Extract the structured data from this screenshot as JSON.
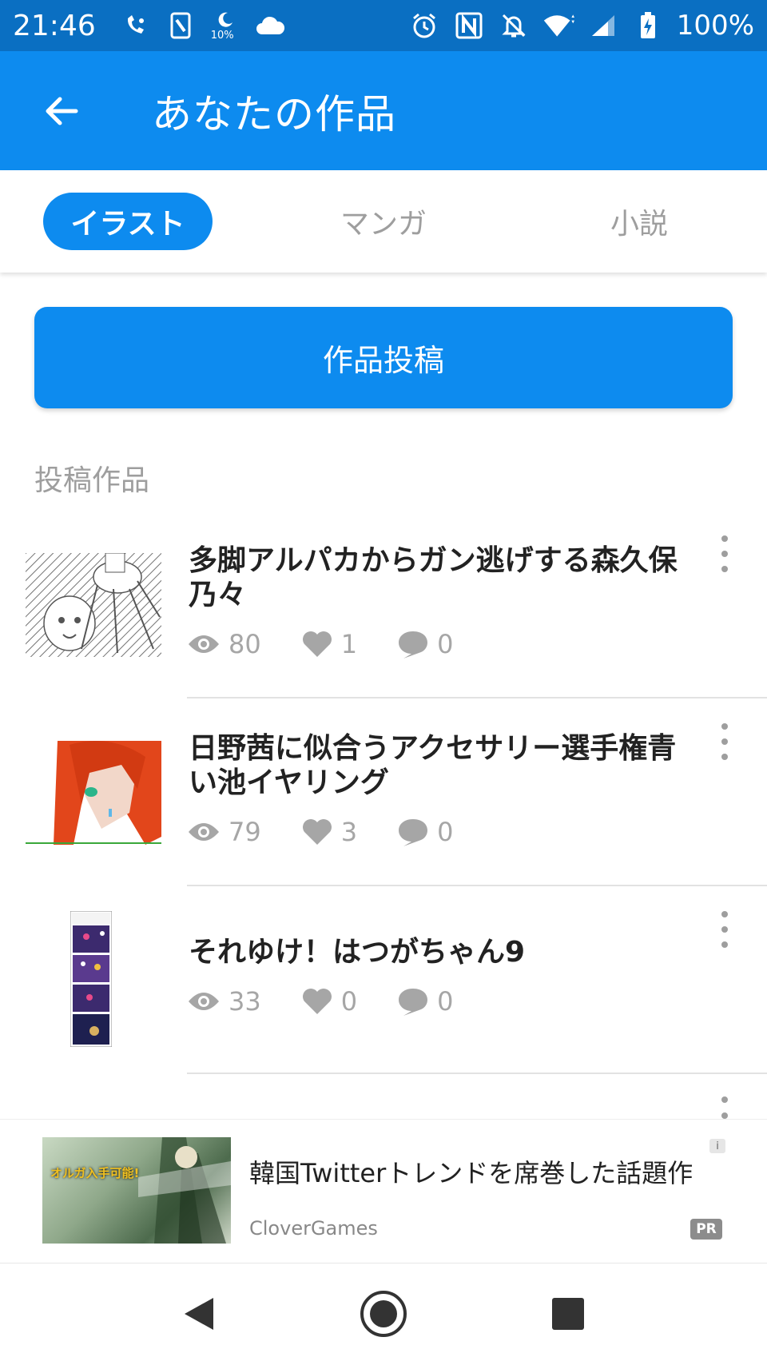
{
  "status_bar": {
    "time": "21:46",
    "moon_percent": "10%",
    "battery": "100%",
    "icons_left": [
      "wifi-calling-icon",
      "nfc-card-icon",
      "moon-icon",
      "cloud-icon"
    ],
    "icons_right": [
      "alarm-icon",
      "nfc-icon",
      "notifications-off-icon",
      "wifi-icon",
      "signal-icon",
      "battery-charging-icon"
    ]
  },
  "header": {
    "title": "あなたの作品"
  },
  "tabs": [
    {
      "label": "イラスト",
      "active": true
    },
    {
      "label": "マンガ",
      "active": false
    },
    {
      "label": "小説",
      "active": false
    }
  ],
  "post_button": {
    "label": "作品投稿"
  },
  "section": {
    "label": "投稿作品"
  },
  "works": [
    {
      "title": "多脚アルパカからガン逃げする森久保乃々",
      "views": "80",
      "likes": "1",
      "comments": "0"
    },
    {
      "title": "日野茜に似合うアクセサリー選手権青い池イヤリング",
      "views": "79",
      "likes": "3",
      "comments": "0"
    },
    {
      "title": "それゆけ！はつがちゃん9",
      "views": "33",
      "likes": "0",
      "comments": "0"
    }
  ],
  "ad": {
    "title": "韓国Twitterトレンドを席巻した話題作",
    "source": "CloverGames",
    "pr_label": "PR",
    "info_label": "i",
    "image_text": "オルガ入手可能!"
  },
  "colors": {
    "status_bar": "#0a6fc2",
    "app_bar": "#0d8bef",
    "accent": "#0d8bef",
    "muted": "#9e9e9e"
  }
}
